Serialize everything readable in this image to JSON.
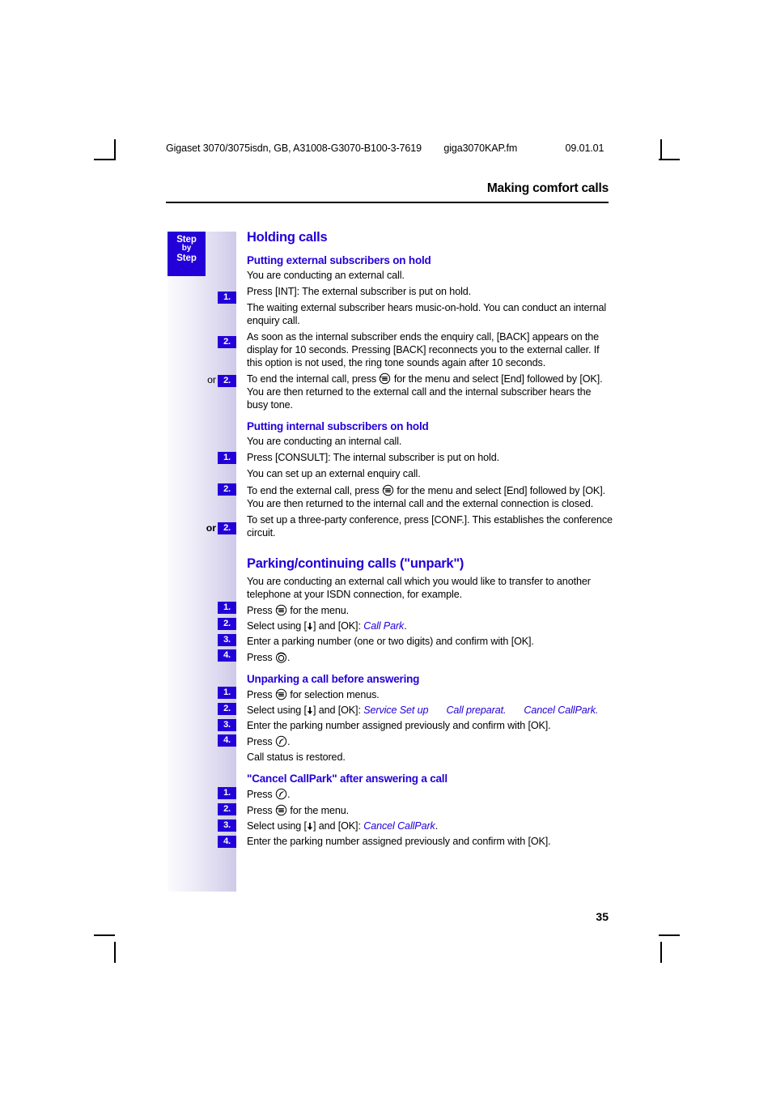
{
  "header": {
    "doc_id": "Gigaset 3070/3075isdn, GB, A31008-G3070-B100-3-7619",
    "file_name": "giga3070KAP.fm",
    "date": "09.01.01",
    "chapter": "Making comfort calls"
  },
  "sidebar": {
    "step_box_line1": "Step",
    "step_box_line2": "by",
    "step_box_line3": "Step",
    "or_label": "or",
    "badges": [
      "1.",
      "2.",
      "2.",
      "1.",
      "2.",
      "2.",
      "1.",
      "2.",
      "3.",
      "4.",
      "1.",
      "2.",
      "3.",
      "4.",
      "1.",
      "2.",
      "3.",
      "4."
    ]
  },
  "sections": {
    "holding_calls": {
      "title": "Holding calls",
      "external": {
        "title": "Putting external subscribers on hold",
        "intro": "You are conducting an external call.",
        "step1": "Press [INT]: The external subscriber is put on hold.",
        "note1": "The waiting external subscriber hears music-on-hold. You can conduct an internal enquiry call.",
        "step2": "As soon as the internal subscriber ends the enquiry call, [BACK] appears on the display for 10 seconds. Pressing [BACK] reconnects you to the external caller. If this option is not used, the ring tone sounds again after 10 seconds.",
        "step2_or_a": "To end the internal call, press",
        "step2_or_b": "for the menu and select [End] followed by [OK]. You are then returned to the external call and the internal subscriber hears the busy tone."
      },
      "internal": {
        "title": "Putting internal subscribers on hold",
        "intro": "You are conducting an internal call.",
        "step1": "Press [CONSULT]: The internal subscriber is put on hold.",
        "note1": "You can set up an external enquiry call.",
        "step2_a": "To end the external call, press",
        "step2_b": "for the menu and select [End] followed by [OK]. You are then returned to the internal call and the external connection is closed.",
        "step2_or": "To set up a three-party conference, press [CONF.]. This establishes the conference circuit."
      }
    },
    "parking": {
      "title": "Parking/continuing calls (\"unpark\")",
      "intro": "You are conducting an external call which you would like to transfer to another telephone at your ISDN connection, for example.",
      "step1_a": "Press",
      "step1_b": "for the menu.",
      "step2_a": "Select using [",
      "step2_b": "] and [OK]:",
      "step2_menu": "Call Park",
      "step2_end": ".",
      "step3": "Enter a parking number (one or two digits) and confirm with [OK].",
      "step4_a": "Press",
      "step4_b": "."
    },
    "unparking": {
      "title": "Unparking a call before answering",
      "step1_a": "Press",
      "step1_b": "for selection menus.",
      "step2_a": "Select using [",
      "step2_b": "] and [OK]:",
      "step2_menu1": "Service Set up",
      "step2_menu2": "Call preparat.",
      "step2_menu3": "Cancel CallPark.",
      "step3": "Enter the parking number assigned previously and confirm with [OK].",
      "step4_a": "Press",
      "step4_b": ".",
      "note": "Call status is restored."
    },
    "cancel_callpark": {
      "title": "\"Cancel CallPark\" after answering a call",
      "step1_a": "Press",
      "step1_b": ".",
      "step2_a": "Press",
      "step2_b": "for the menu.",
      "step3_a": "Select using [",
      "step3_b": "] and [OK]:",
      "step3_menu": "Cancel CallPark",
      "step3_end": ".",
      "step4": "Enter the parking number assigned previously and confirm with [OK]."
    }
  },
  "footer": {
    "page_number": "35"
  },
  "colors": {
    "accent_blue": "#2300d8",
    "sidebar_gradient_start": "#fbfbfe",
    "sidebar_gradient_end": "#cfc9e8"
  }
}
